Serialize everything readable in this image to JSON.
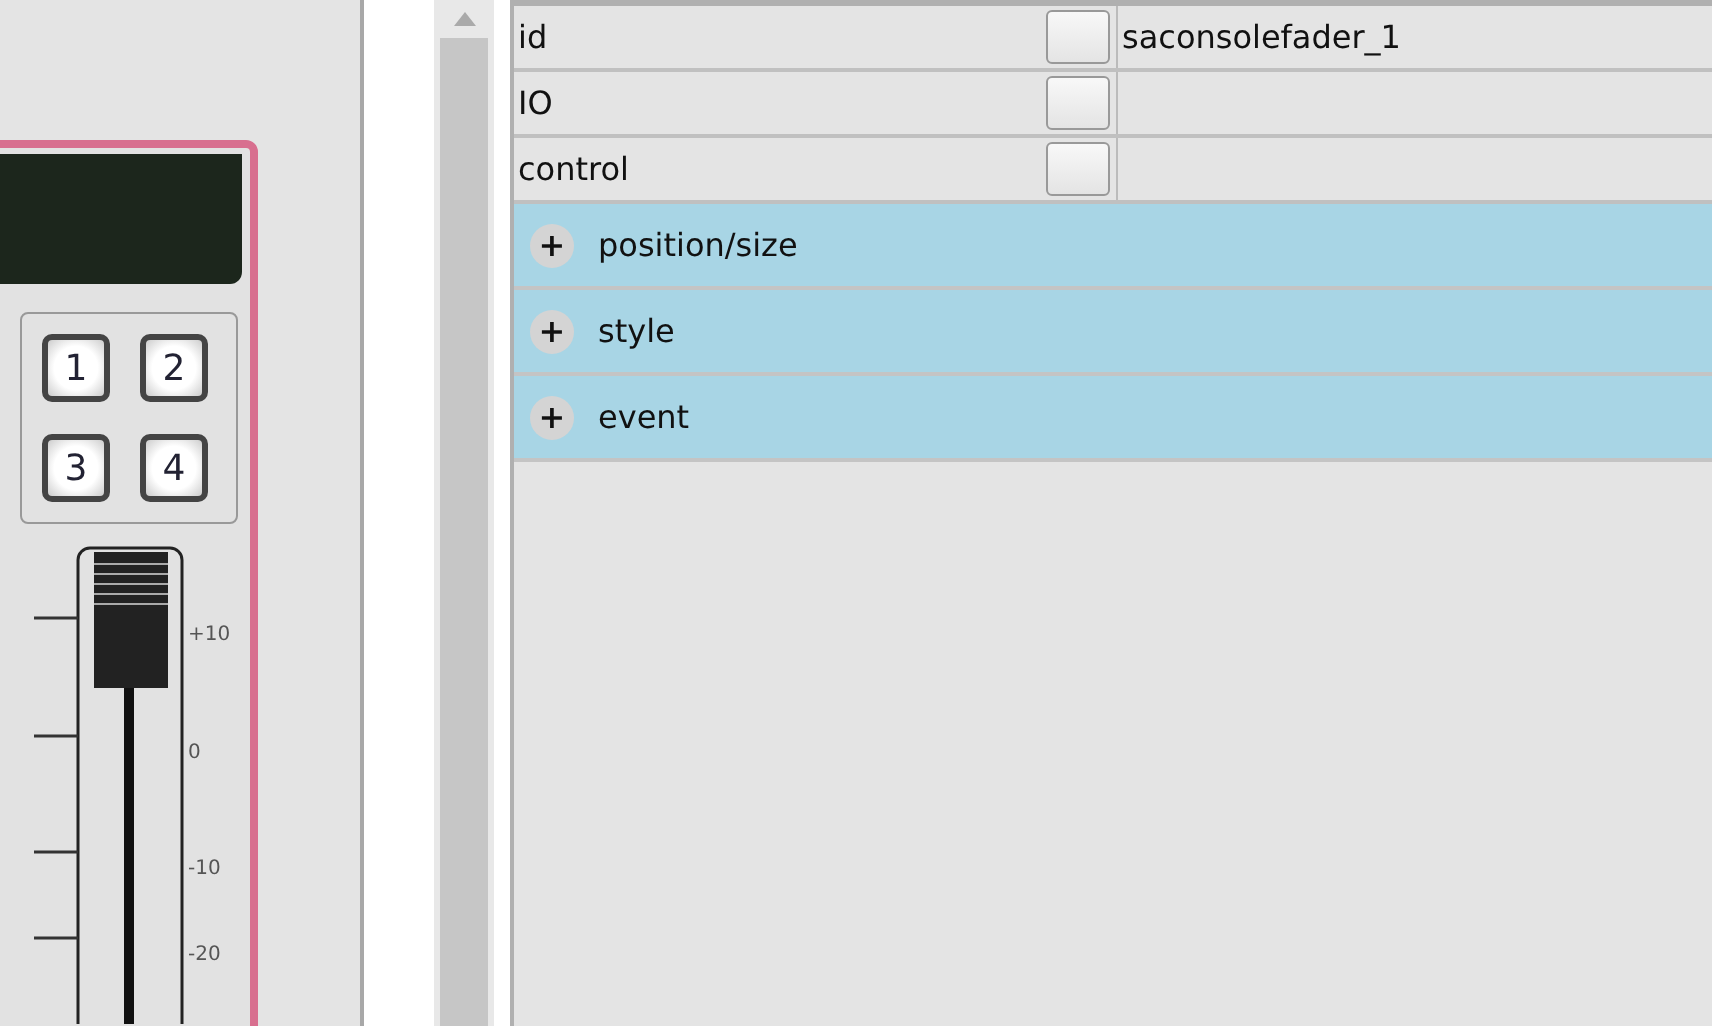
{
  "fader_widget": {
    "buttons": [
      "1",
      "2",
      "3",
      "4"
    ],
    "scale": [
      "+10",
      "0",
      "-10",
      "-20"
    ]
  },
  "properties": {
    "rows": [
      {
        "name": "id",
        "value": "saconsolefader_1"
      },
      {
        "name": "IO"
      },
      {
        "name": "control"
      }
    ],
    "groups": [
      {
        "icon": "+",
        "label": "position/size"
      },
      {
        "icon": "+",
        "label": "style"
      },
      {
        "icon": "+",
        "label": "event"
      }
    ]
  }
}
